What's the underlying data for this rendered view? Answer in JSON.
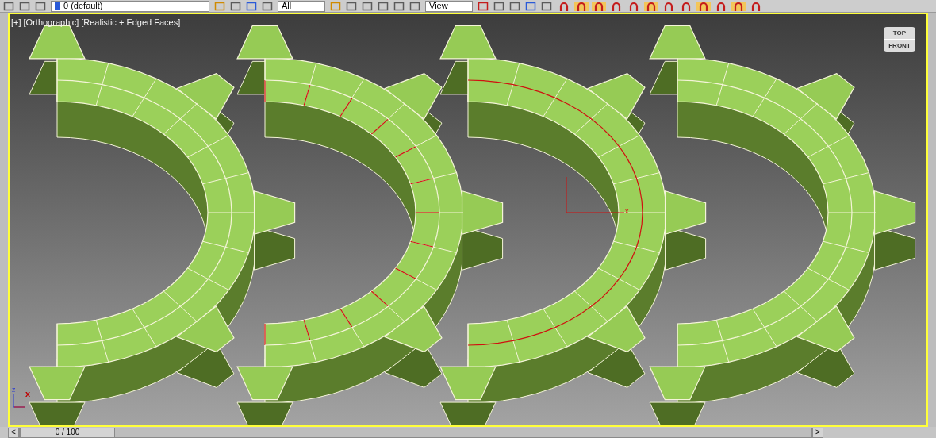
{
  "toolbar": {
    "layer_dropdown": "0 (default)",
    "selection_filter": "All",
    "reference_coord": "View"
  },
  "viewport": {
    "labels": [
      "[+]",
      "[Orthographic]",
      "[Realistic + Edged Faces]"
    ],
    "viewcube": {
      "top": "TOP",
      "front": "FRONT"
    },
    "axis": {
      "z": "z",
      "x": "x"
    },
    "gizmo_label": "x"
  },
  "timeline": {
    "prev": "<",
    "frame": "0 / 100",
    "level": 0,
    "next": ">"
  }
}
